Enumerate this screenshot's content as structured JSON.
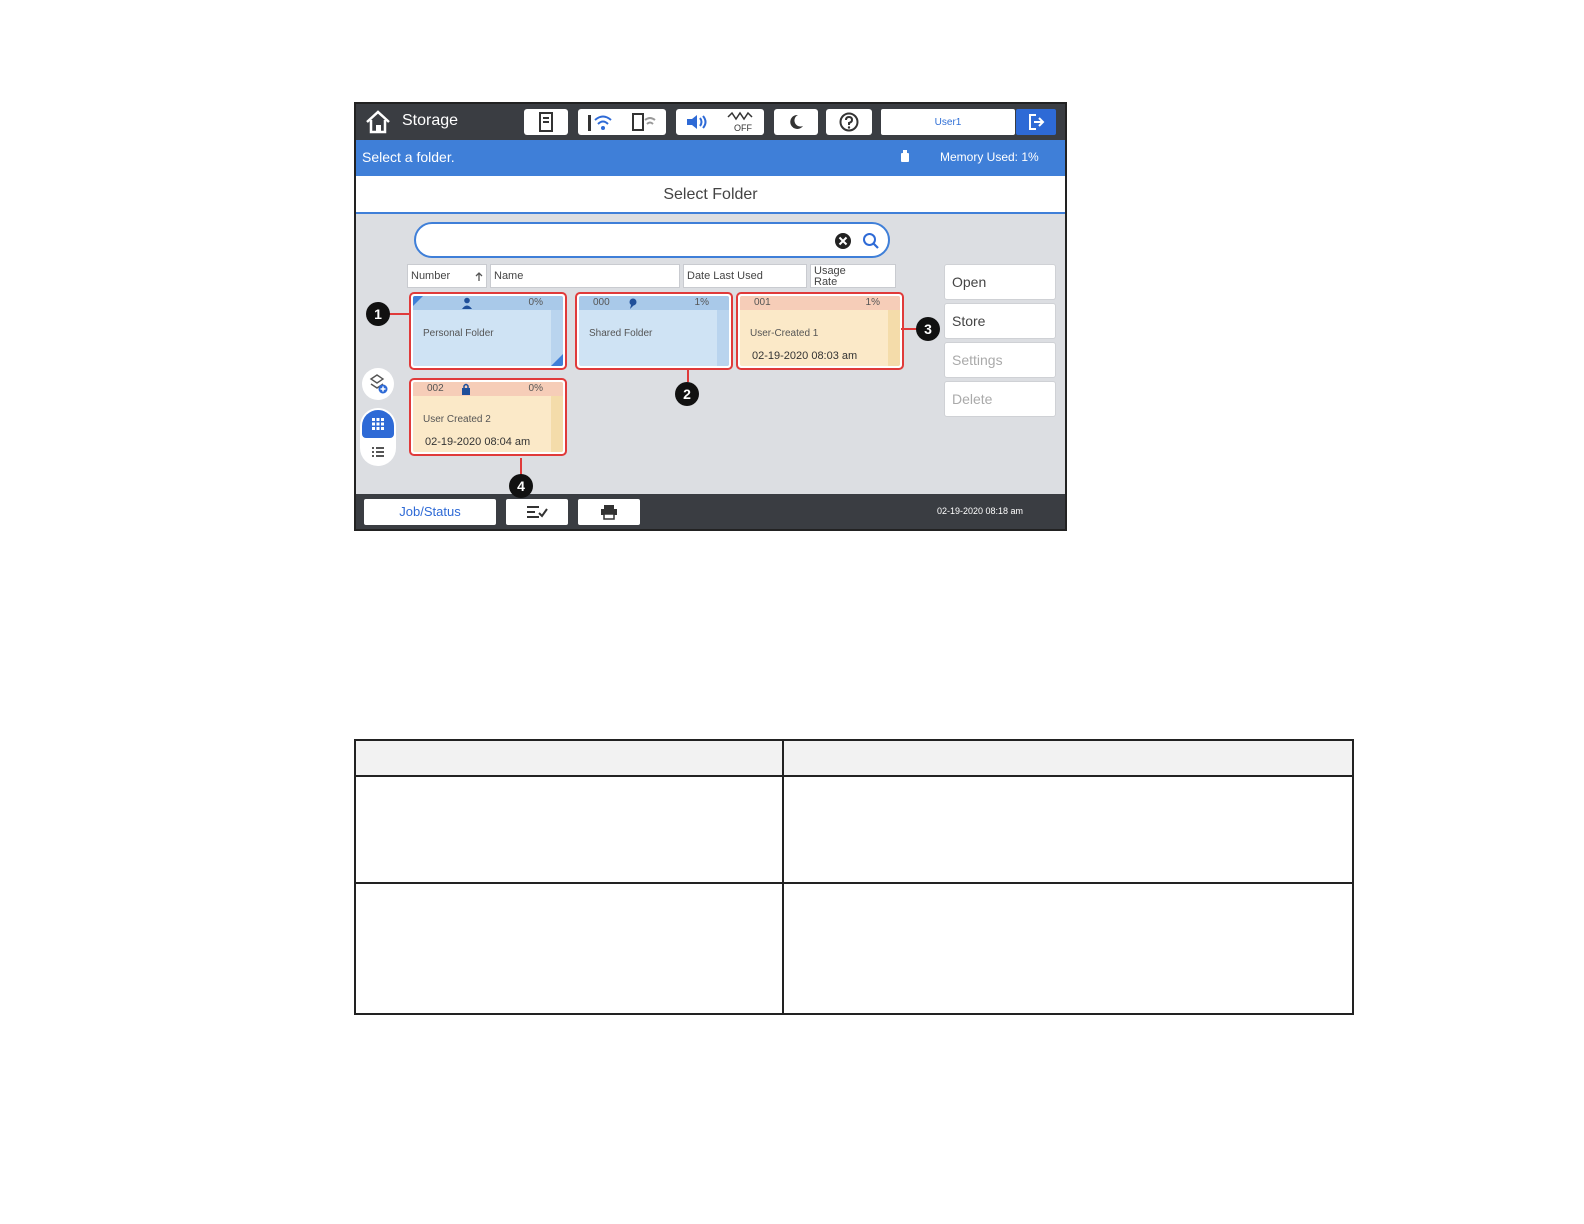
{
  "topbar": {
    "title": "Storage",
    "user": "User1",
    "icons": [
      "home-icon",
      "sd-card-icon",
      "wifi-icon",
      "wifi-direct-icon",
      "volume-icon",
      "eco-off-icon",
      "sleep-icon",
      "help-icon",
      "logout-icon"
    ],
    "eco_label": "OFF"
  },
  "status": {
    "message": "Select a folder.",
    "memory": "Memory Used: 1%"
  },
  "header": {
    "title": "Select Folder"
  },
  "search": {
    "value": "",
    "placeholder": ""
  },
  "columns": [
    {
      "label": "Number"
    },
    {
      "label": "Name"
    },
    {
      "label": "Date Last Used"
    },
    {
      "label": "Usage\nRate"
    }
  ],
  "folders": [
    {
      "number": "",
      "usage": "0%",
      "name": "Personal Folder",
      "date": "",
      "kind": "personal"
    },
    {
      "number": "000",
      "usage": "1%",
      "name": "Shared Folder",
      "date": "",
      "kind": "shared"
    },
    {
      "number": "001",
      "usage": "1%",
      "name": "User-Created 1",
      "date": "02-19-2020 08:03 am",
      "kind": "user"
    },
    {
      "number": "002",
      "usage": "0%",
      "name": "User Created 2",
      "date": "02-19-2020 08:04 am",
      "kind": "locked"
    }
  ],
  "actions": [
    {
      "label": "Open",
      "enabled": true
    },
    {
      "label": "Store",
      "enabled": true
    },
    {
      "label": "Settings",
      "enabled": false
    },
    {
      "label": "Delete",
      "enabled": false
    }
  ],
  "bottombar": {
    "job_status": "Job/Status",
    "clock": "02-19-2020 08:18 am"
  },
  "callouts": [
    "1",
    "2",
    "3",
    "4"
  ],
  "colors": {
    "accent": "#3f7fd8",
    "topbar": "#3a3d42",
    "highlight": "#e03a3a",
    "tile_blue": "#cfe3f4",
    "tile_orange": "#fbe9c8"
  }
}
